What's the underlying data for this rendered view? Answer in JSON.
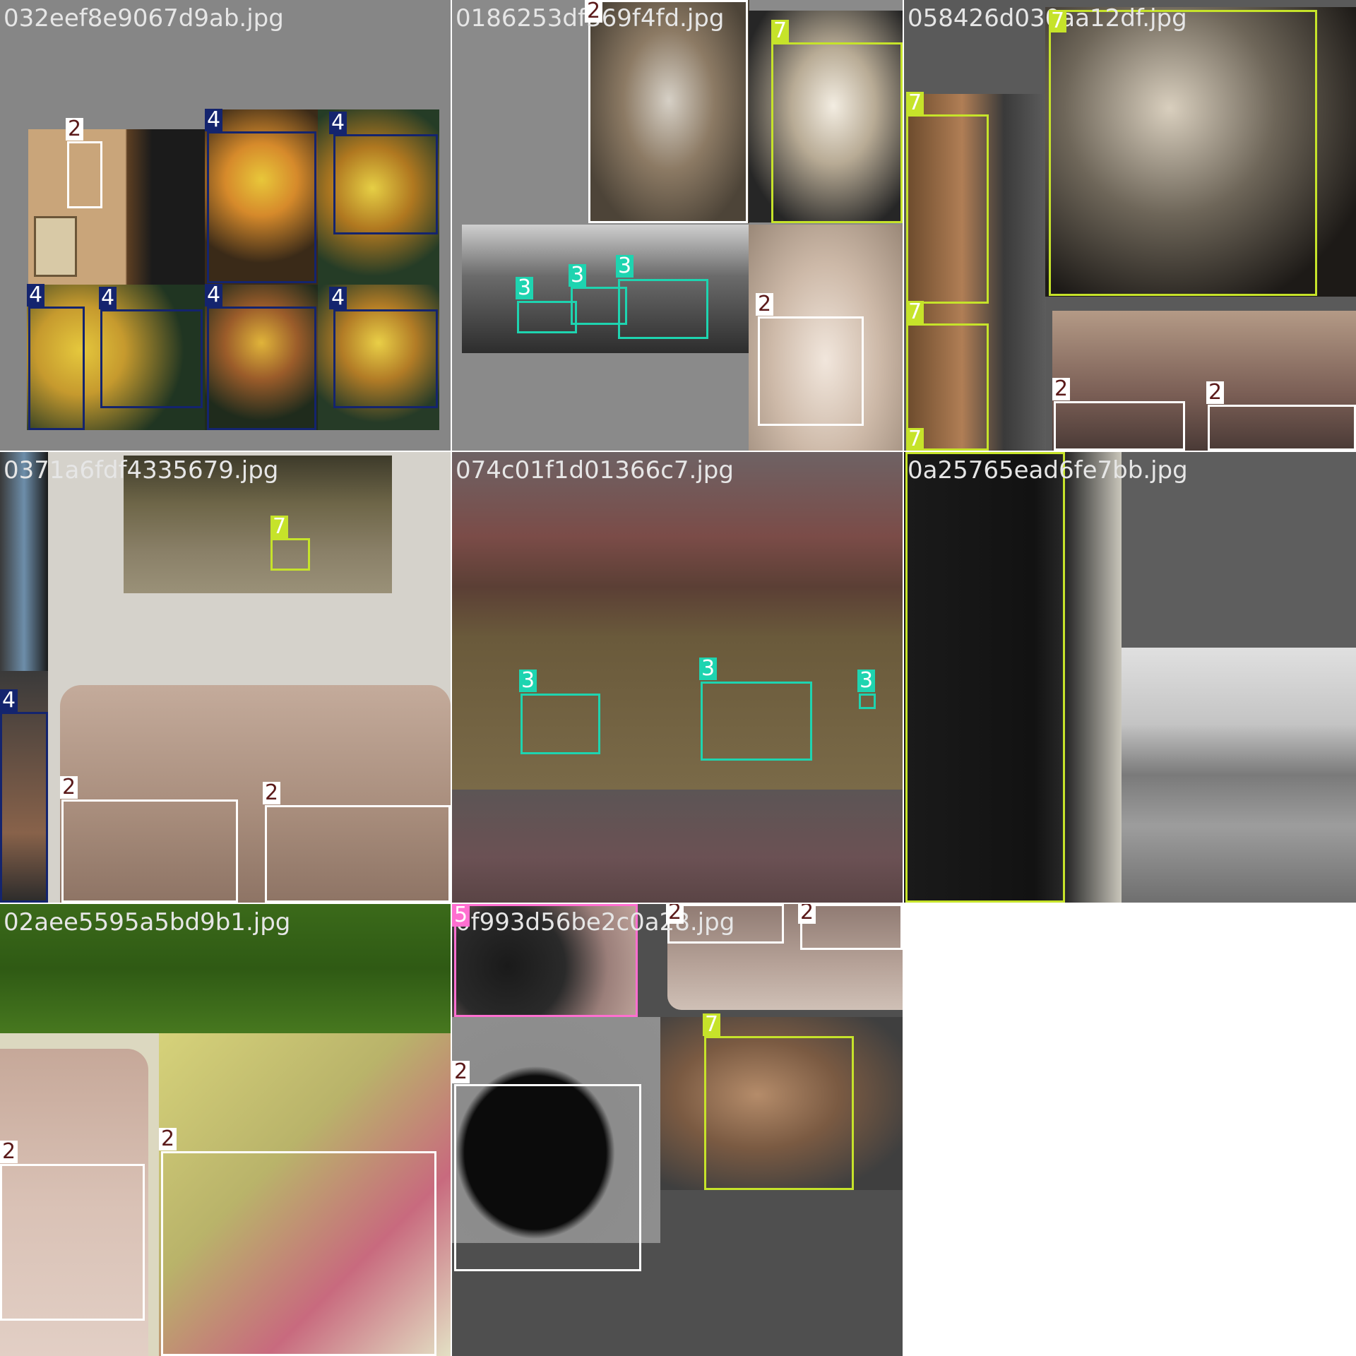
{
  "tiles": [
    {
      "filename": "032eef8e9067d9ab.jpg"
    },
    {
      "filename": "0186253df369f4fd.jpg"
    },
    {
      "filename": "058426d030aa12df.jpg"
    },
    {
      "filename": "0371a6fdf4335679.jpg"
    },
    {
      "filename": "074c01f1d01366c7.jpg"
    },
    {
      "filename": "0a25765ead6fe7bb.jpg"
    },
    {
      "filename": "02aee5595a5bd9b1.jpg"
    },
    {
      "filename": "0f993d56be2c0a28.jpg"
    }
  ],
  "class_colors": {
    "2": "#ffffff",
    "3": "#1ed4b0",
    "4": "#14246e",
    "5": "#ff6fd0",
    "7": "#c6e32a"
  },
  "labels": {
    "two": "2",
    "three": "3",
    "four": "4",
    "five": "5",
    "seven": "7"
  }
}
